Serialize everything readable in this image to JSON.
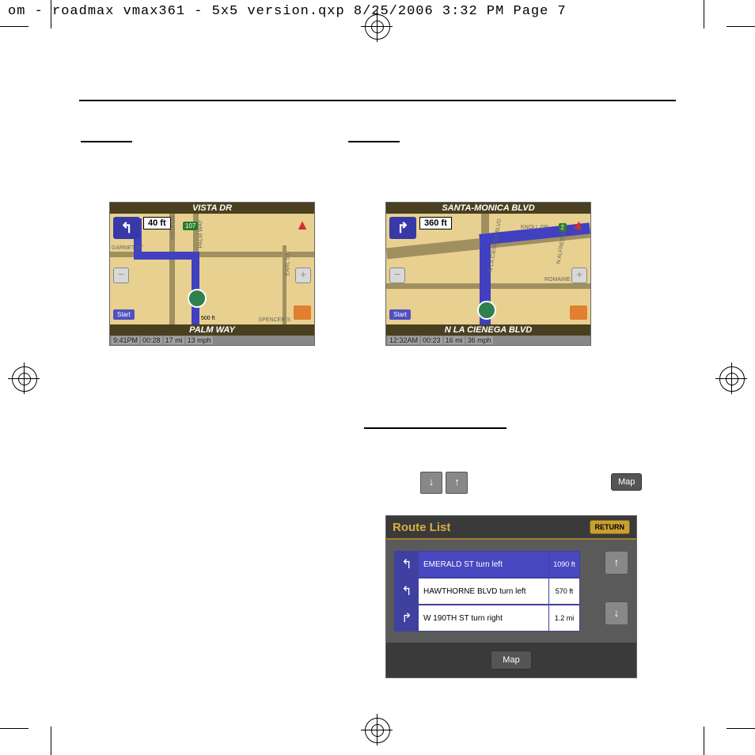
{
  "header_line": "om - roadmax vmax361 - 5x5 version.qxp  8/25/2006  3:32 PM  Page 7",
  "gps1": {
    "top_street": "VISTA DR",
    "bottom_street": "PALM WAY",
    "distance": "40 ft",
    "time": "9:41PM",
    "remaining": "00:28",
    "dist_remain": "17 mi",
    "speed": "13 mph",
    "start": "Start",
    "streets": {
      "garnet": "GARNET ST",
      "vista": "VISTA DR",
      "palm": "PALM WAY",
      "earl": "EARL ST",
      "spencer": "SPENCER S",
      "scale": "500 ft"
    },
    "shield": "107"
  },
  "gps2": {
    "top_street": "SANTA-MONICA BLVD",
    "bottom_street": "N LA CIENEGA BLVD",
    "distance": "360 ft",
    "time": "12:32AM",
    "remaining": "00:23",
    "dist_remain": "16 mi",
    "speed": "36 mph",
    "start": "Start",
    "streets": {
      "romaine": "ROMAINE ST",
      "knoll": "KNOLL DR",
      "alfred": "N ALFRED ST",
      "cienega": "N LA CIENEGA BLVD"
    },
    "shield": "2"
  },
  "route": {
    "title": "Route List",
    "return": "RETURN",
    "map": "Map",
    "items": [
      {
        "dir": "↰",
        "text": "EMERALD ST turn left",
        "dist": "1090 ft",
        "sel": true
      },
      {
        "dir": "↰",
        "text": "HAWTHORNE BLVD turn left",
        "dist": "570 ft",
        "sel": false
      },
      {
        "dir": "↱",
        "text": "W 190TH ST turn right",
        "dist": "1.2 mi",
        "sel": false
      }
    ]
  },
  "buttons": {
    "map": "Map"
  }
}
